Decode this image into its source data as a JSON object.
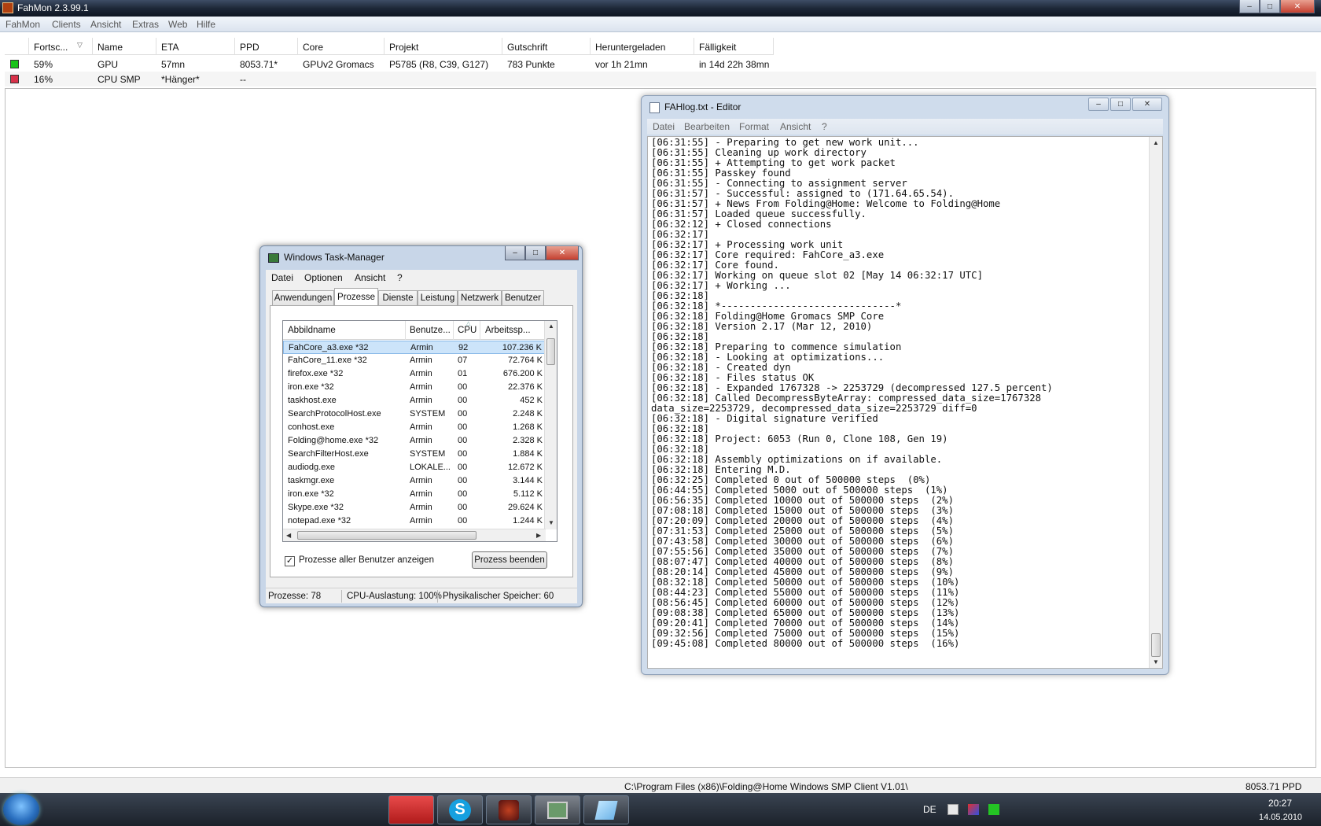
{
  "fahmon": {
    "title": "FahMon 2.3.99.1",
    "menu": [
      "FahMon",
      "Clients",
      "Ansicht",
      "Extras",
      "Web",
      "Hilfe"
    ],
    "columns": [
      "Fortsc...",
      "Name",
      "ETA",
      "PPD",
      "Core",
      "Projekt",
      "Gutschrift",
      "Heruntergeladen",
      "Fälligkeit"
    ],
    "rows": [
      {
        "state_color": "#19c419",
        "progress": "59%",
        "name": "GPU",
        "eta": "57mn",
        "ppd": "8053.71*",
        "core": "GPUv2 Gromacs",
        "project": "P5785 (R8, C39, G127)",
        "credit": "783 Punkte",
        "downloaded": "vor 1h 21mn",
        "due": "in 14d 22h 38mn"
      },
      {
        "state_color": "#d8324a",
        "progress": "16%",
        "name": "CPU SMP",
        "eta": "*Hänger*",
        "ppd": "--",
        "core": "",
        "project": "",
        "credit": "",
        "downloaded": "",
        "due": ""
      }
    ],
    "status_path": "C:\\Program Files (x86)\\Folding@Home Windows SMP Client V1.01\\",
    "status_ppd": "8053.71 PPD"
  },
  "taskmgr": {
    "title": "Windows Task-Manager",
    "menu": [
      "Datei",
      "Optionen",
      "Ansicht",
      "?"
    ],
    "tabs": [
      "Anwendungen",
      "Prozesse",
      "Dienste",
      "Leistung",
      "Netzwerk",
      "Benutzer"
    ],
    "active_tab": "Prozesse",
    "columns": [
      "Abbildname",
      "Benutze...",
      "CPU",
      "Arbeitssp..."
    ],
    "processes": [
      {
        "name": "FahCore_a3.exe *32",
        "user": "Armin",
        "cpu": "92",
        "mem": "107.236 K"
      },
      {
        "name": "FahCore_11.exe *32",
        "user": "Armin",
        "cpu": "07",
        "mem": "72.764 K"
      },
      {
        "name": "firefox.exe *32",
        "user": "Armin",
        "cpu": "01",
        "mem": "676.200 K"
      },
      {
        "name": "iron.exe *32",
        "user": "Armin",
        "cpu": "00",
        "mem": "22.376 K"
      },
      {
        "name": "taskhost.exe",
        "user": "Armin",
        "cpu": "00",
        "mem": "452 K"
      },
      {
        "name": "SearchProtocolHost.exe",
        "user": "SYSTEM",
        "cpu": "00",
        "mem": "2.248 K"
      },
      {
        "name": "conhost.exe",
        "user": "Armin",
        "cpu": "00",
        "mem": "1.268 K"
      },
      {
        "name": "Folding@home.exe *32",
        "user": "Armin",
        "cpu": "00",
        "mem": "2.328 K"
      },
      {
        "name": "SearchFilterHost.exe",
        "user": "SYSTEM",
        "cpu": "00",
        "mem": "1.884 K"
      },
      {
        "name": "audiodg.exe",
        "user": "LOKALE...",
        "cpu": "00",
        "mem": "12.672 K"
      },
      {
        "name": "taskmgr.exe",
        "user": "Armin",
        "cpu": "00",
        "mem": "3.144 K"
      },
      {
        "name": "iron.exe *32",
        "user": "Armin",
        "cpu": "00",
        "mem": "5.112 K"
      },
      {
        "name": "Skype.exe *32",
        "user": "Armin",
        "cpu": "00",
        "mem": "29.624 K"
      },
      {
        "name": "notepad.exe *32",
        "user": "Armin",
        "cpu": "00",
        "mem": "1.244 K"
      }
    ],
    "show_all_label": "Prozesse aller Benutzer anzeigen",
    "show_all_checked": true,
    "end_process_label": "Prozess beenden",
    "status": [
      "Prozesse: 78",
      "CPU-Auslastung: 100%",
      "Physikalischer Speicher: 60"
    ]
  },
  "editor": {
    "title": "FAHlog.txt - Editor",
    "menu": [
      "Datei",
      "Bearbeiten",
      "Format",
      "Ansicht",
      "?"
    ],
    "lines": [
      "[06:31:55] - Preparing to get new work unit...",
      "[06:31:55] Cleaning up work directory",
      "[06:31:55] + Attempting to get work packet",
      "[06:31:55] Passkey found",
      "[06:31:55] - Connecting to assignment server",
      "[06:31:57] - Successful: assigned to (171.64.65.54).",
      "[06:31:57] + News From Folding@Home: Welcome to Folding@Home",
      "[06:31:57] Loaded queue successfully.",
      "[06:32:12] + Closed connections",
      "[06:32:17]",
      "[06:32:17] + Processing work unit",
      "[06:32:17] Core required: FahCore_a3.exe",
      "[06:32:17] Core found.",
      "[06:32:17] Working on queue slot 02 [May 14 06:32:17 UTC]",
      "[06:32:17] + Working ...",
      "[06:32:18]",
      "[06:32:18] *------------------------------*",
      "[06:32:18] Folding@Home Gromacs SMP Core",
      "[06:32:18] Version 2.17 (Mar 12, 2010)",
      "[06:32:18]",
      "[06:32:18] Preparing to commence simulation",
      "[06:32:18] - Looking at optimizations...",
      "[06:32:18] - Created dyn",
      "[06:32:18] - Files status OK",
      "[06:32:18] - Expanded 1767328 -> 2253729 (decompressed 127.5 percent)",
      "[06:32:18] Called DecompressByteArray: compressed_data_size=1767328",
      "data_size=2253729, decompressed_data_size=2253729 diff=0",
      "[06:32:18] - Digital signature verified",
      "[06:32:18]",
      "[06:32:18] Project: 6053 (Run 0, Clone 108, Gen 19)",
      "[06:32:18]",
      "[06:32:18] Assembly optimizations on if available.",
      "[06:32:18] Entering M.D.",
      "[06:32:25] Completed 0 out of 500000 steps  (0%)",
      "[06:44:55] Completed 5000 out of 500000 steps  (1%)",
      "[06:56:35] Completed 10000 out of 500000 steps  (2%)",
      "[07:08:18] Completed 15000 out of 500000 steps  (3%)",
      "[07:20:09] Completed 20000 out of 500000 steps  (4%)",
      "[07:31:53] Completed 25000 out of 500000 steps  (5%)",
      "[07:43:58] Completed 30000 out of 500000 steps  (6%)",
      "[07:55:56] Completed 35000 out of 500000 steps  (7%)",
      "[08:07:47] Completed 40000 out of 500000 steps  (8%)",
      "[08:20:14] Completed 45000 out of 500000 steps  (9%)",
      "[08:32:18] Completed 50000 out of 500000 steps  (10%)",
      "[08:44:23] Completed 55000 out of 500000 steps  (11%)",
      "[08:56:45] Completed 60000 out of 500000 steps  (12%)",
      "[09:08:38] Completed 65000 out of 500000 steps  (13%)",
      "[09:20:41] Completed 70000 out of 500000 steps  (14%)",
      "[09:32:56] Completed 75000 out of 500000 steps  (15%)",
      "[09:45:08] Completed 80000 out of 500000 steps  (16%)"
    ]
  },
  "taskbar": {
    "language": "DE",
    "time": "20:27",
    "date": "14.05.2010",
    "icons": [
      "start-orb-icon",
      "red-app-icon",
      "skype-icon",
      "fahmon-icon",
      "task-manager-icon",
      "notepad-icon"
    ]
  }
}
